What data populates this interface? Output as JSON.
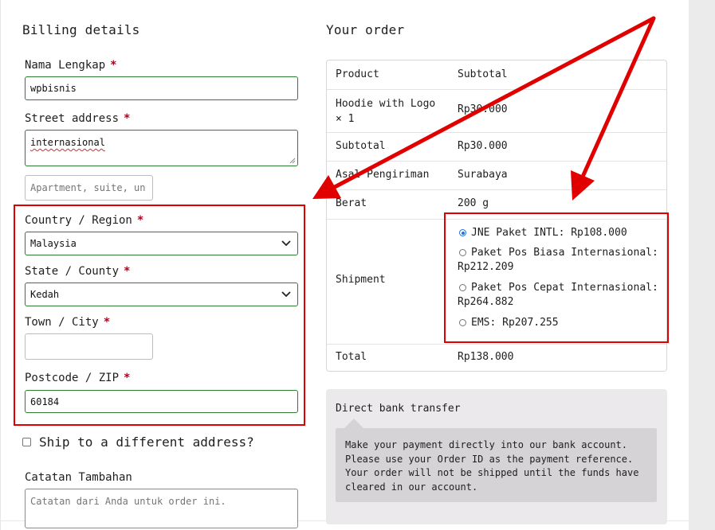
{
  "billing": {
    "title": "Billing details",
    "required_mark": "*",
    "name_label": "Nama Lengkap",
    "name_value": "wpbisnis",
    "street_label": "Street address",
    "street_value": "internasional",
    "apartment_placeholder": "Apartment, suite, un",
    "country_label": "Country / Region",
    "country_value": "Malaysia",
    "state_label": "State / County",
    "state_value": "Kedah",
    "town_label": "Town / City",
    "town_value": "",
    "postcode_label": "Postcode / ZIP",
    "postcode_value": "60184",
    "ship_different_label": "Ship to a different address?",
    "notes_label": "Catatan Tambahan",
    "notes_placeholder": "Catatan dari Anda untuk order ini."
  },
  "order": {
    "title": "Your order",
    "col_product": "Product",
    "col_subtotal": "Subtotal",
    "item_name_line1": "Hoodie with Logo",
    "item_name_line2": "× 1",
    "item_price": "Rp30.000",
    "subtotal_label": "Subtotal",
    "subtotal_value": "Rp30.000",
    "origin_label": "Asal Pengiriman",
    "origin_value": "Surabaya",
    "weight_label": "Berat",
    "weight_value": "200 g",
    "shipment_label": "Shipment",
    "shipping_options": [
      {
        "line1": "JNE Paket INTL: Rp108.000",
        "line2": "",
        "selected": true
      },
      {
        "line1": "Paket Pos Biasa Internasional:",
        "line2": "Rp212.209",
        "selected": false
      },
      {
        "line1": "Paket Pos Cepat Internasional:",
        "line2": "Rp264.882",
        "selected": false
      },
      {
        "line1": "EMS: Rp207.255",
        "line2": "",
        "selected": false
      }
    ],
    "total_label": "Total",
    "total_value": "Rp138.000"
  },
  "payment": {
    "method": "Direct bank transfer",
    "desc_line1": "Make your payment directly into our bank account.",
    "desc_line2": "Please use your Order ID as the payment reference.",
    "desc_line3": "Your order will not be shipped until the funds have",
    "desc_line4": "cleared in our account."
  },
  "annotation_color": "#e00000",
  "valid_field_border": "#2e7d32",
  "radio_selected_color": "#1a73e8"
}
